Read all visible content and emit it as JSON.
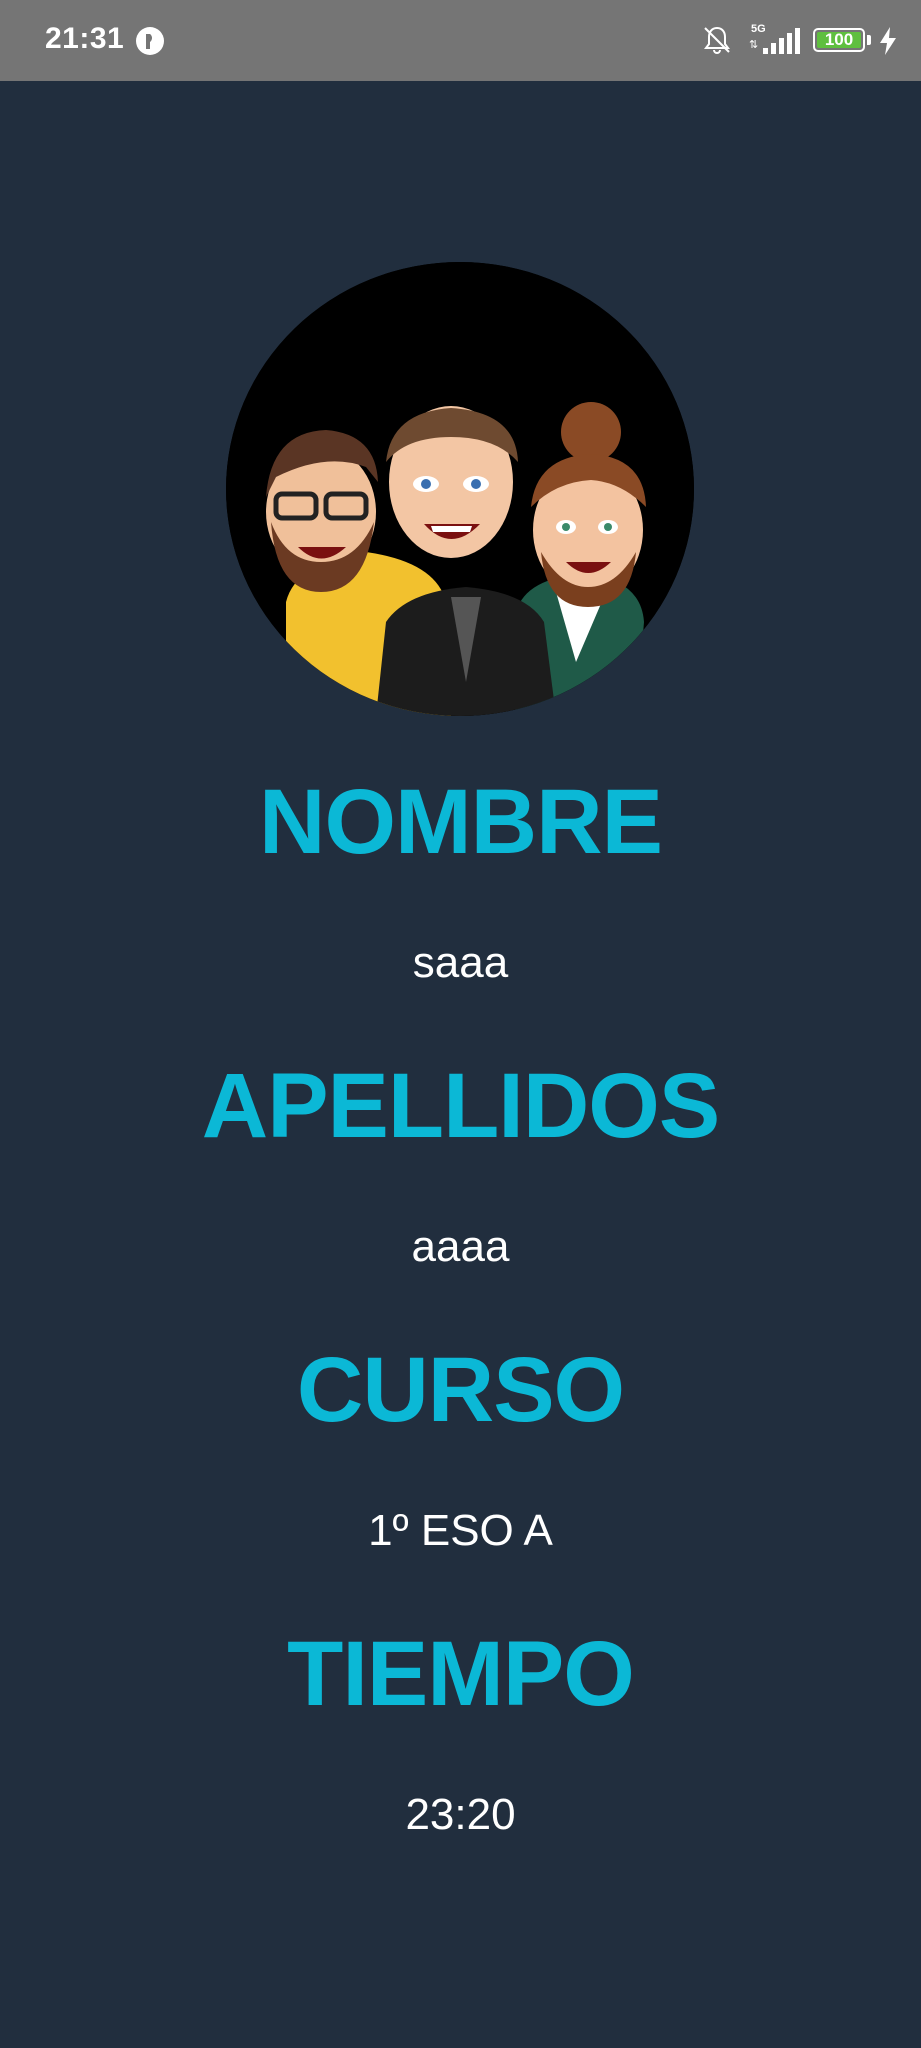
{
  "status_bar": {
    "time": "21:31",
    "network": "5G",
    "battery": "100"
  },
  "profile": {
    "avatar_icon": "group-avatar-icon"
  },
  "fields": {
    "nombre_label": "NOMBRE",
    "nombre_value": "saaa",
    "apellidos_label": "APELLIDOS",
    "apellidos_value": "aaaa",
    "curso_label": "CURSO",
    "curso_value": "1º ESO A",
    "tiempo_label": "TIEMPO",
    "tiempo_value": "23:20"
  },
  "colors": {
    "background": "#212e3e",
    "accent": "#0bb8d6",
    "status_bar": "#757575",
    "battery": "#5fbf3f"
  }
}
